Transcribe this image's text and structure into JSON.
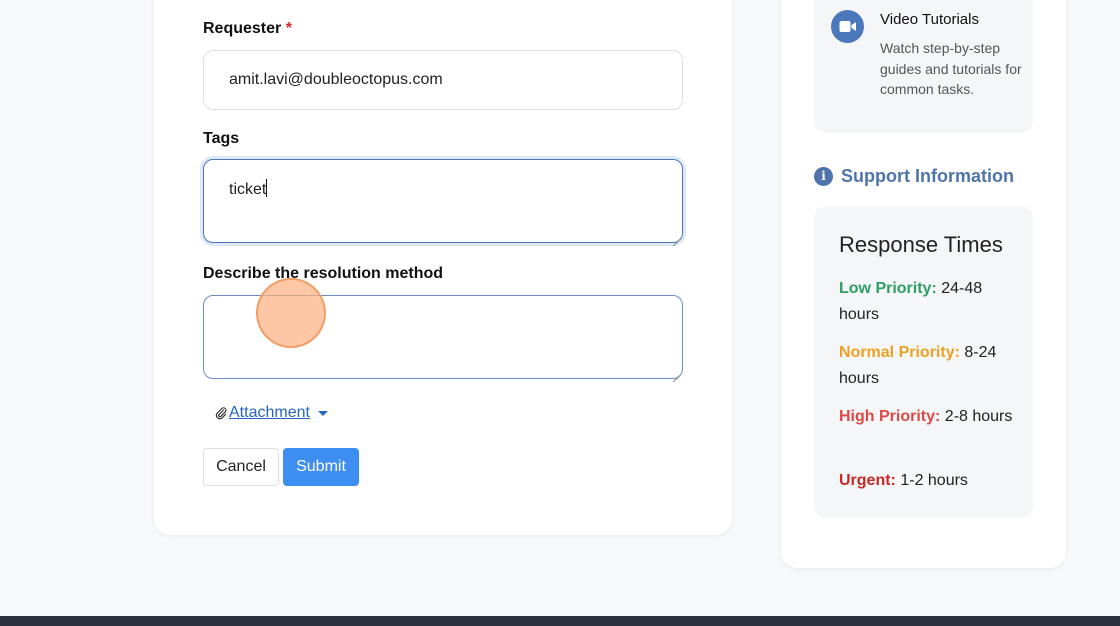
{
  "form": {
    "requester_label": "Requester",
    "required_marker": "*",
    "requester_value": "amit.lavi@doubleoctopus.com",
    "tags_label": "Tags",
    "tags_value": "ticket",
    "description_label": "Describe the resolution method",
    "description_value": "",
    "attachment_label": " Attachment ",
    "cancel_label": "Cancel",
    "submit_label": "Submit"
  },
  "sidebar": {
    "video": {
      "title": "Video Tutorials",
      "description": "Watch step-by-step guides and tutorials for common tasks.",
      "icon": "video-camera-icon"
    },
    "support": {
      "heading": "Support Information",
      "icon": "info-icon",
      "response_title": "Response Times",
      "priorities": [
        {
          "label": "Low Priority:",
          "value": " 24-48 hours",
          "color": "#2e9e64"
        },
        {
          "label": "Normal Priority:",
          "value": " 8-24 hours",
          "color": "#eca125"
        },
        {
          "label": "High Priority:",
          "value": " 2-8 hours",
          "color": "#df4747"
        },
        {
          "label": "Urgent:",
          "value": " 1-2 hours",
          "color": "#c62828"
        }
      ]
    }
  },
  "colors": {
    "accent": "#3d8ef0",
    "link": "#2466c4",
    "support_heading": "#4e74ab",
    "footer": "#2b3240"
  }
}
